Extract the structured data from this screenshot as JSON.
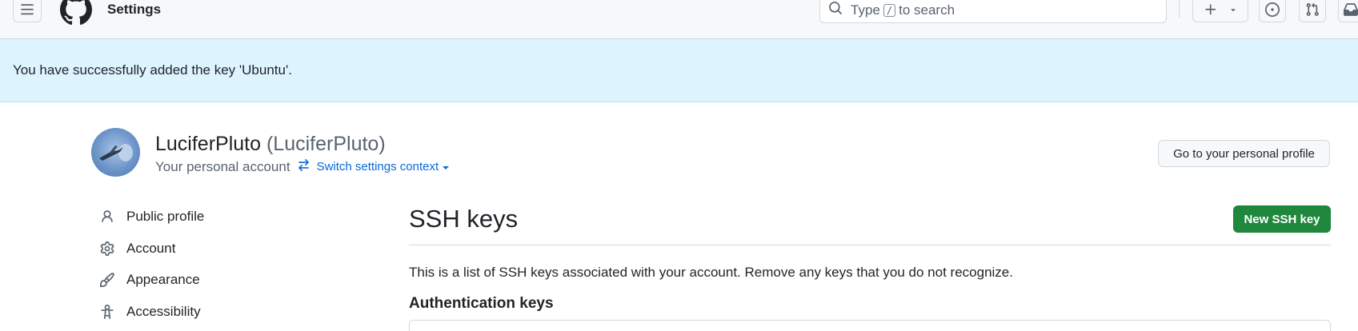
{
  "header": {
    "context_title": "Settings",
    "search": {
      "prefix": "Type",
      "kbd": "/",
      "suffix": "to search"
    }
  },
  "flash": {
    "message": "You have successfully added the key 'Ubuntu'."
  },
  "account": {
    "name": "LuciferPluto",
    "login": "(LuciferPluto)",
    "subtitle": "Your personal account",
    "switch_label": "Switch settings context",
    "profile_button": "Go to your personal profile"
  },
  "sidebar": {
    "items": [
      {
        "label": "Public profile",
        "icon": "person-icon"
      },
      {
        "label": "Account",
        "icon": "gear-icon"
      },
      {
        "label": "Appearance",
        "icon": "paintbrush-icon"
      },
      {
        "label": "Accessibility",
        "icon": "accessibility-icon"
      }
    ]
  },
  "main": {
    "title": "SSH keys",
    "new_button": "New SSH key",
    "description": "This is a list of SSH keys associated with your account. Remove any keys that you do not recognize.",
    "section_title": "Authentication keys"
  },
  "colors": {
    "flash_bg": "#ddf4ff",
    "primary_button": "#1f883d",
    "link": "#0969da",
    "muted_text": "#59636e"
  }
}
